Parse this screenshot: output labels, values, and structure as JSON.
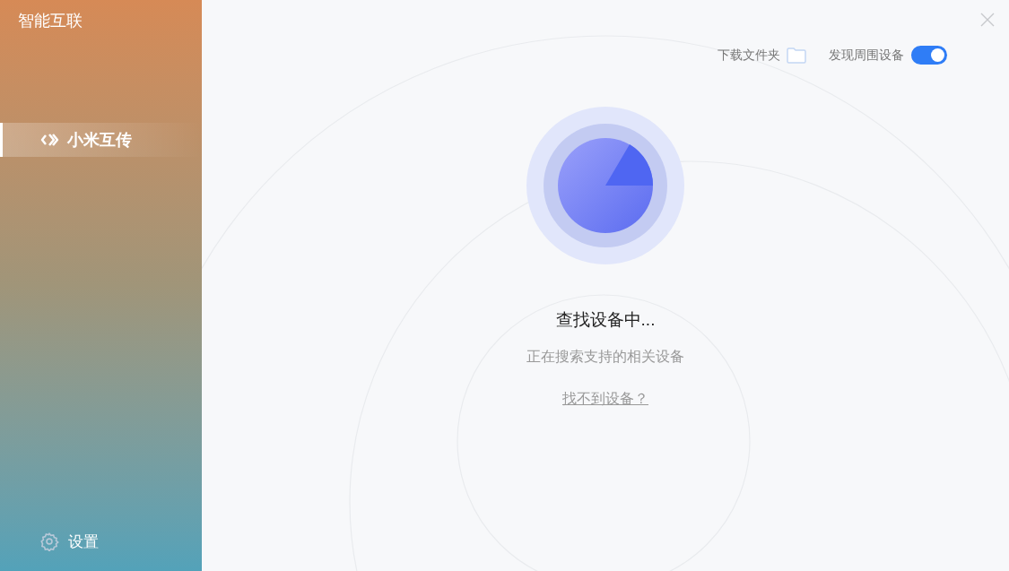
{
  "app_title": "智能互联",
  "sidebar": {
    "items": [
      {
        "label": "小米互传",
        "selected": true
      }
    ],
    "settings": "设置"
  },
  "toolbar": {
    "download_folder": "下载文件夹",
    "discover": {
      "label": "发现周围设备",
      "on": true
    }
  },
  "status": {
    "title": "查找设备中...",
    "subtitle": "正在搜索支持的相关设备",
    "help_link": "找不到设备？"
  }
}
